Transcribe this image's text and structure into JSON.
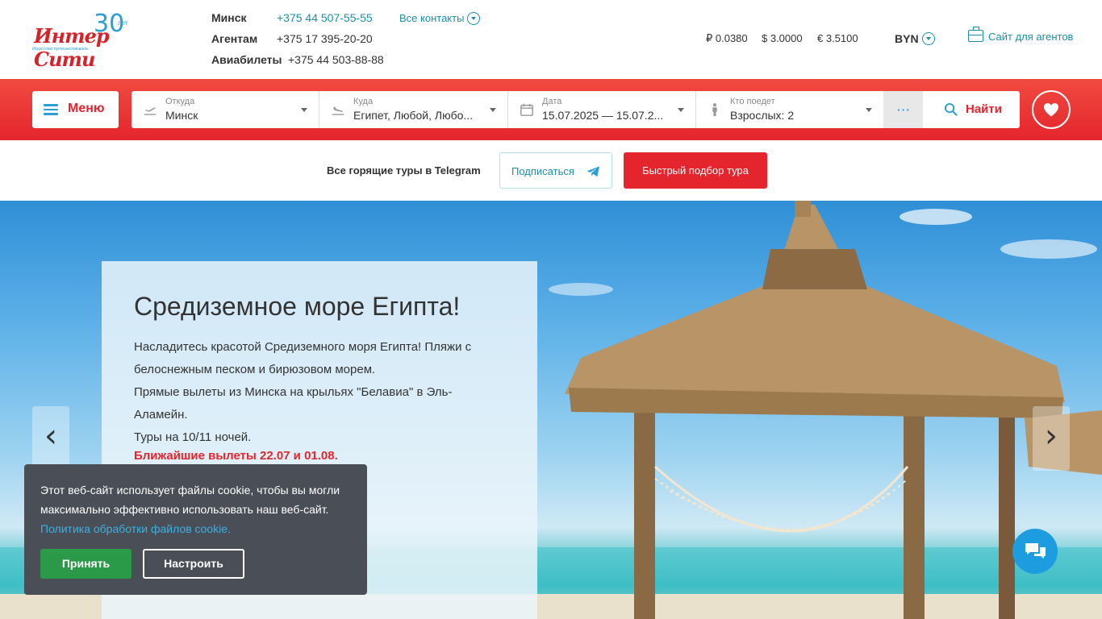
{
  "brand": {
    "logo_text": "Интер Сити",
    "logo_anniversary": "30",
    "logo_anniversary_suffix": "лет",
    "logo_tagline": "Искусство путешествовать",
    "primary_color": "#e5252d",
    "accent_color": "#2a9fd6"
  },
  "contacts": {
    "rows": [
      {
        "label": "Минск",
        "phone": "+375 44 507-55-55"
      },
      {
        "label": "Агентам",
        "phone": "+375 17 395-20-20"
      },
      {
        "label": "Авиабилеты",
        "phone": "+375 44 503-88-88"
      }
    ],
    "all_contacts_label": "Все контакты"
  },
  "rates": {
    "rub": "₽ 0.0380",
    "usd": "$ 3.0000",
    "eur": "€ 3.5100"
  },
  "currency": {
    "selected": "BYN"
  },
  "agents_link": "Сайт для агентов",
  "menu": {
    "label": "Меню"
  },
  "search": {
    "from": {
      "label": "Откуда",
      "value": "Минск"
    },
    "to": {
      "label": "Куда",
      "value": "Египет, Любой, Любо..."
    },
    "date": {
      "label": "Дата",
      "value": "15.07.2025 — 15.07.2..."
    },
    "who": {
      "label": "Кто поедет",
      "value": "Взрослых: 2"
    },
    "more_label": "···",
    "find_label": "Найти"
  },
  "telegram": {
    "label": "Все горящие туры в Telegram",
    "subscribe_label": "Подписаться",
    "quick_pick_label": "Быстрый подбор тура"
  },
  "hero": {
    "title": "Средиземное море Египта!",
    "lines": [
      "Насладитесь красотой Средиземного моря Египта! Пляжи с белоснежным песком и бирюзовом морем.",
      "Прямые вылеты из Минска на крыльях \"Белавиа\" в Эль-Аламейн.",
      "Туры на 10/11 ночей."
    ],
    "highlight": "Ближайшие вылеты 22.07 и 01.08.",
    "prev_label": "‹",
    "next_label": "›"
  },
  "cookie": {
    "text": "Этот веб-сайт использует файлы cookie, чтобы вы могли максимально эффективно использовать наш веб-сайт.",
    "link_text": "Политика обработки файлов cookie.",
    "accept_label": "Принять",
    "settings_label": "Настроить"
  }
}
